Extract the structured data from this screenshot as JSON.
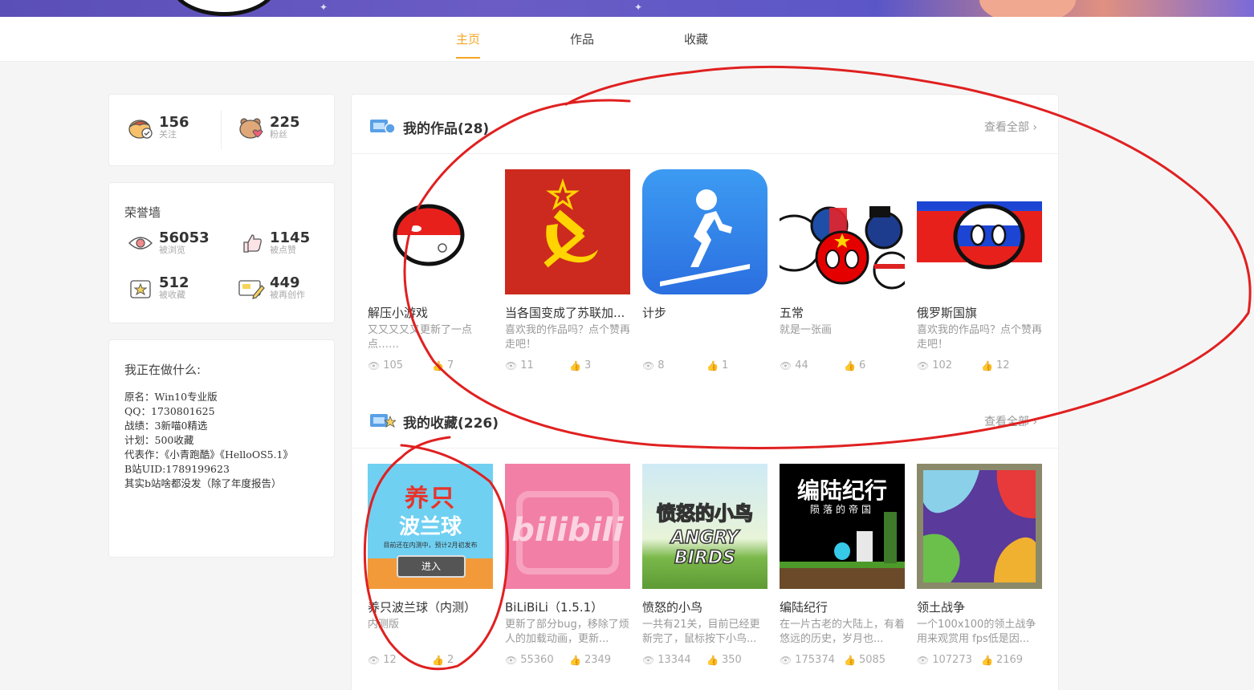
{
  "nav": {
    "tabs": [
      "主页",
      "作品",
      "收藏"
    ]
  },
  "stats": [
    {
      "value": "156",
      "label": "关注"
    },
    {
      "value": "225",
      "label": "粉丝"
    }
  ],
  "honor": {
    "title": "荣誉墙",
    "items": [
      {
        "value": "56053",
        "label": "被浏览"
      },
      {
        "value": "1145",
        "label": "被点赞"
      },
      {
        "value": "512",
        "label": "被收藏"
      },
      {
        "value": "449",
        "label": "被再创作"
      }
    ]
  },
  "doing": {
    "title": "我正在做什么:",
    "lines": "原名：Win10专业版\nQQ：1730801625\n战绩：3新喵0精选\n计划：500收藏\n代表作：《小青跑酷》《HelloOS5.1》\nB站UID:1789199623\n其实b站啥都没发（除了年度报告）"
  },
  "works": {
    "title": "我的作品(28)",
    "more": "查看全部",
    "items": [
      {
        "title": "解压小游戏",
        "desc": "又又又又又更新了一点点……",
        "views": "105",
        "likes": "7"
      },
      {
        "title": "当各国变成了苏联加...",
        "desc": "喜欢我的作品吗？点个赞再走吧！",
        "views": "11",
        "likes": "3"
      },
      {
        "title": "计步",
        "desc": "",
        "views": "8",
        "likes": "1"
      },
      {
        "title": "五常",
        "desc": "就是一张画",
        "views": "44",
        "likes": "6"
      },
      {
        "title": "俄罗斯国旗",
        "desc": "喜欢我的作品吗？点个赞再走吧！",
        "views": "102",
        "likes": "12"
      }
    ]
  },
  "favs": {
    "title": "我的收藏(226)",
    "more": "查看全部",
    "items": [
      {
        "title": "养只波兰球（内测）",
        "desc": "内测版",
        "views": "12",
        "likes": "2",
        "thumb_text": [
          "养只",
          "波兰球",
          "目前还在内测中，预计2月初发布",
          "进入"
        ]
      },
      {
        "title": "BiLiBiLi（1.5.1）",
        "desc": "更新了部分bug，移除了烦人的加载动画，更新...",
        "views": "55360",
        "likes": "2349",
        "thumb_text": [
          "bilibili"
        ]
      },
      {
        "title": "愤怒的小鸟",
        "desc": "一共有21关，目前已经更新完了，鼠标按下小鸟...",
        "views": "13344",
        "likes": "350",
        "thumb_text": [
          "愤怒的小鸟",
          "ANGRY BIRDS"
        ]
      },
      {
        "title": "编陆纪行",
        "desc": "在一片古老的大陆上，有着悠远的历史，岁月也...",
        "views": "175374",
        "likes": "5085",
        "thumb_text": [
          "编陆纪行",
          "陨落的帝国"
        ]
      },
      {
        "title": "领土战争",
        "desc": "一个100x100的领土战争用来观赏用 fps低是因...",
        "views": "107273",
        "likes": "2169"
      }
    ]
  },
  "colors": {
    "accent": "#f5a623",
    "annotation": "#e02020"
  }
}
